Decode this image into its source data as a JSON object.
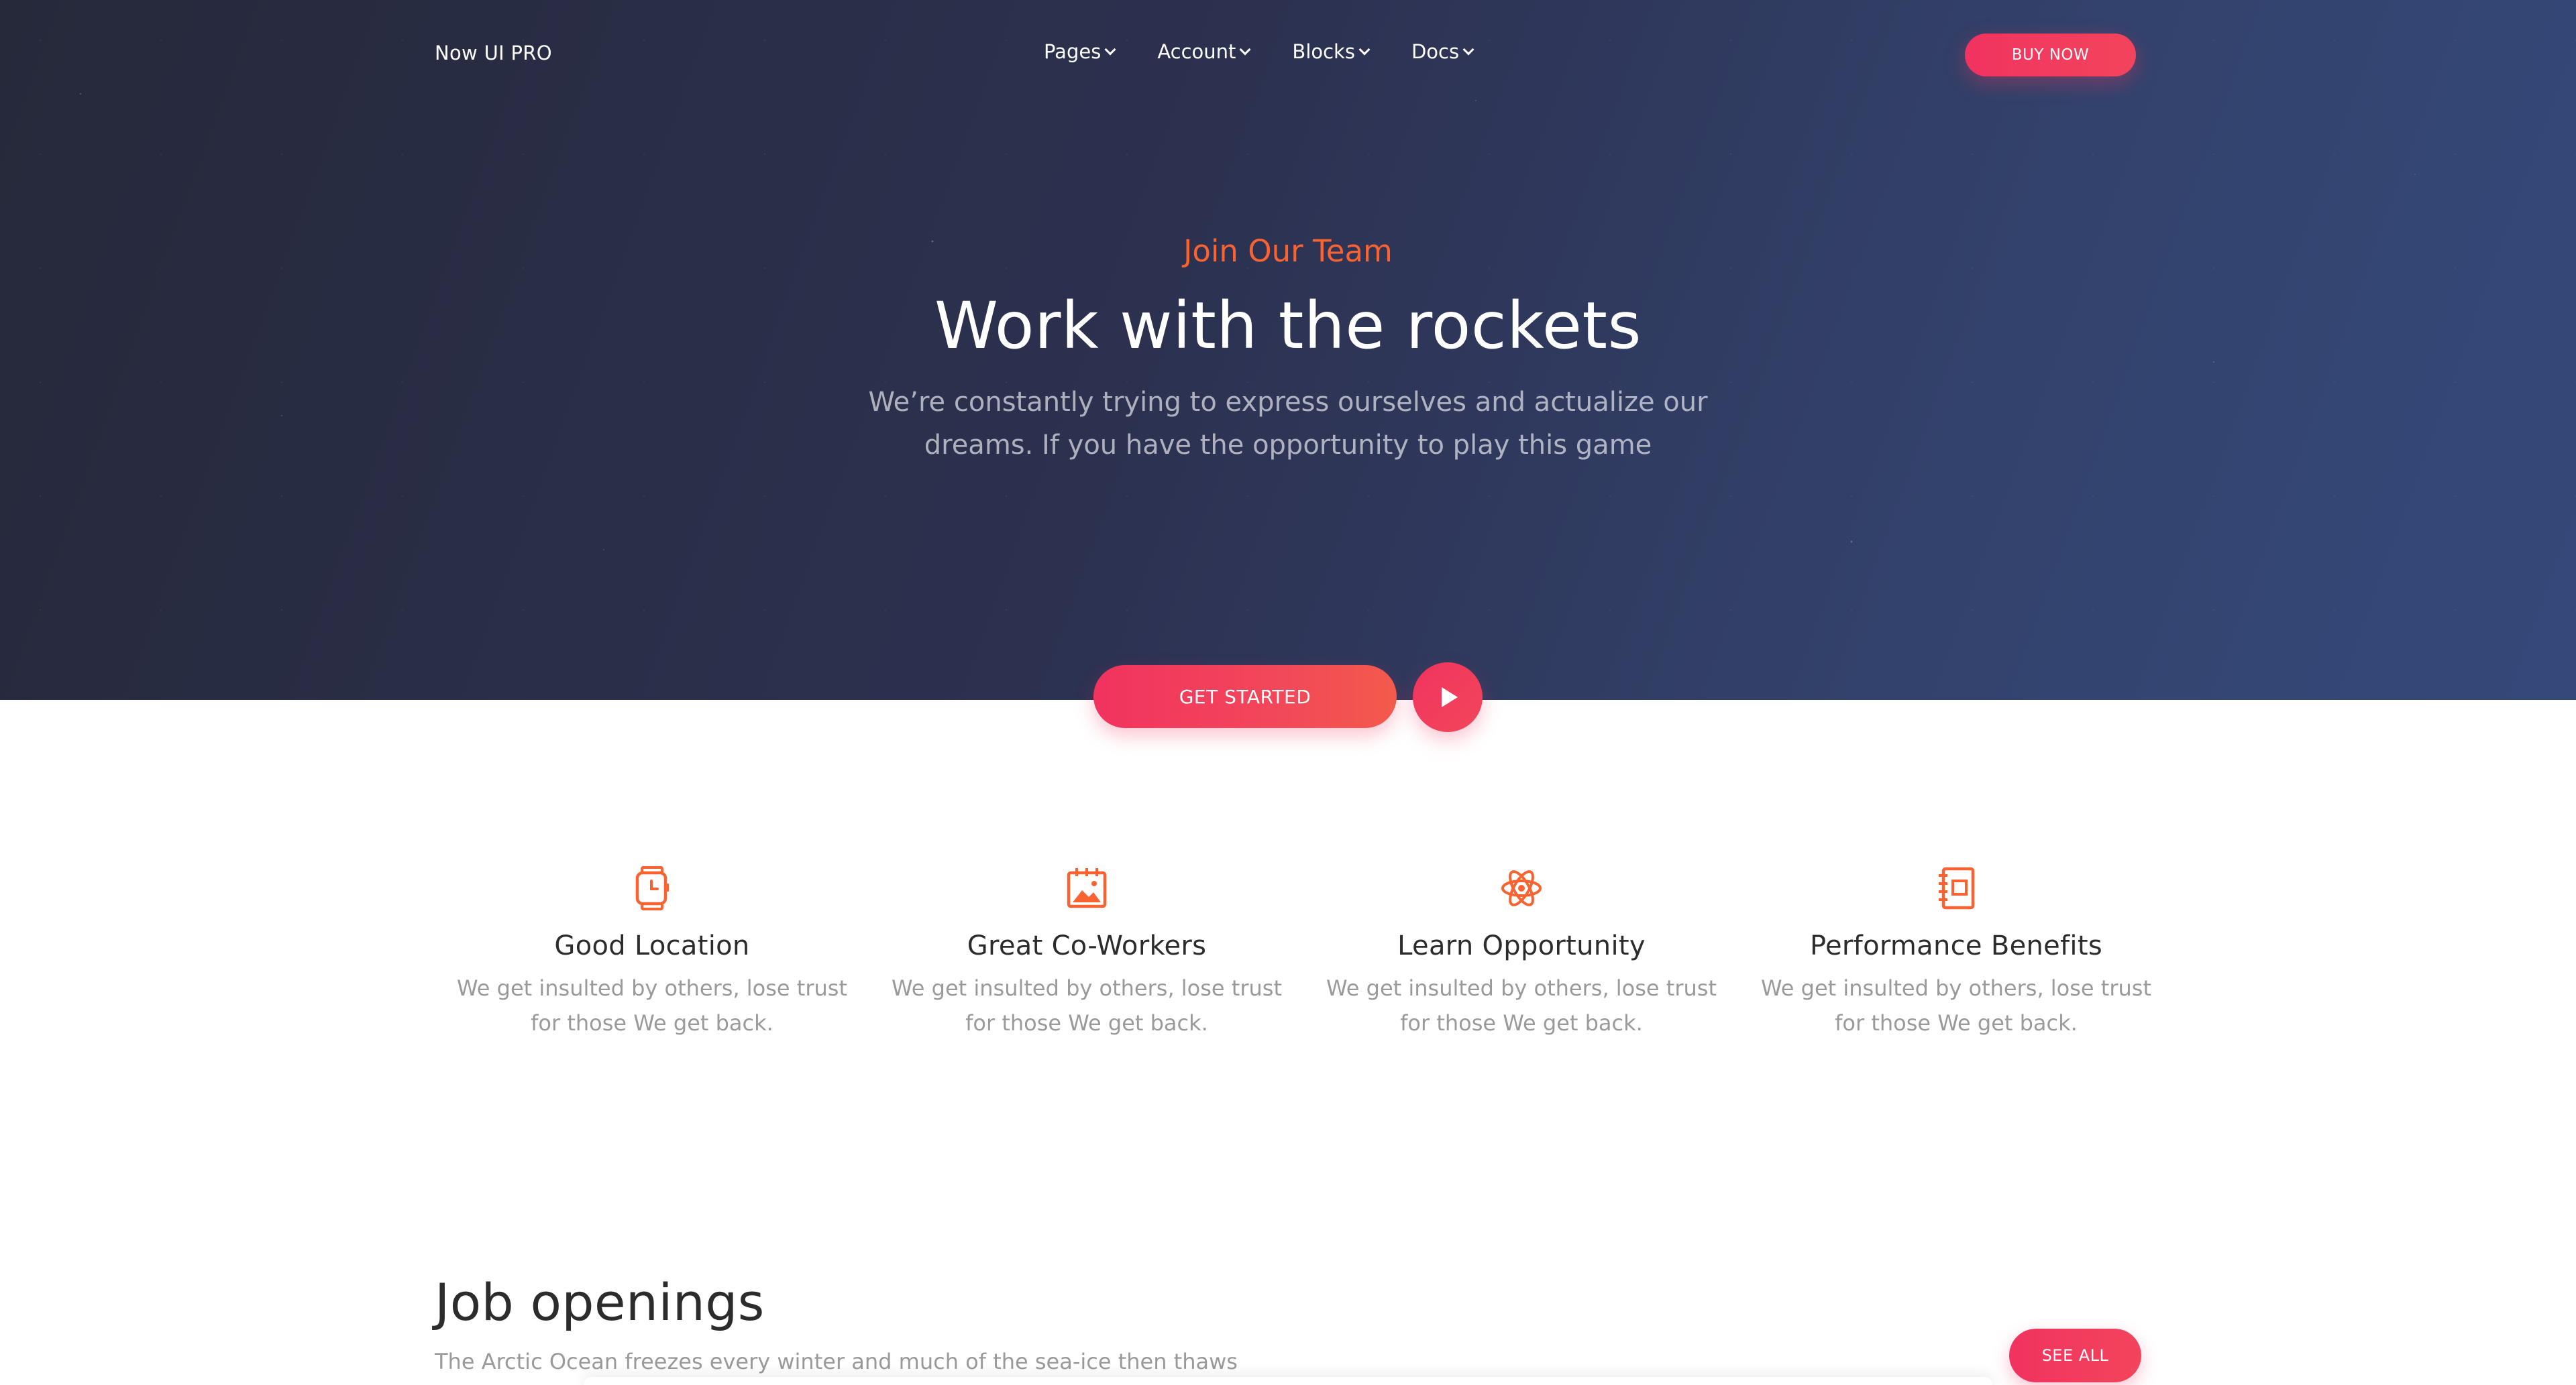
{
  "navbar": {
    "brand": "Now UI PRO",
    "items": [
      {
        "label": "Pages"
      },
      {
        "label": "Account"
      },
      {
        "label": "Blocks"
      },
      {
        "label": "Docs"
      }
    ],
    "buy_label": "BUY NOW"
  },
  "hero": {
    "kicker": "Join Our Team",
    "title": "Work with the rockets",
    "description": "We’re constantly trying to express ourselves and actualize our dreams. If you have the opportunity to play this game",
    "cta_label": "GET STARTED",
    "play_icon": "play-icon"
  },
  "features": [
    {
      "icon": "watch-icon",
      "title": "Good Location",
      "description": "We get insulted by others, lose trust for those We get back."
    },
    {
      "icon": "image-calendar-icon",
      "title": "Great Co-Workers",
      "description": "We get insulted by others, lose trust for those We get back."
    },
    {
      "icon": "atom-icon",
      "title": "Learn Opportunity",
      "description": "We get insulted by others, lose trust for those We get back."
    },
    {
      "icon": "notebook-icon",
      "title": "Performance Benefits",
      "description": "We get insulted by others, lose trust for those We get back."
    }
  ],
  "jobs": {
    "title": "Job openings",
    "description": "The Arctic Ocean freezes every winter and much of the sea-ice then thaws",
    "see_all_label": "SEE ALL"
  },
  "colors": {
    "accent": "#f96332",
    "primary_gradient_start": "#f1335f",
    "primary_gradient_end": "#f35a4b",
    "hero_bg_left": "#26293a",
    "hero_bg_right": "#34497a",
    "muted_text": "#9a9a9a",
    "heading_text": "#2c2c2c"
  }
}
